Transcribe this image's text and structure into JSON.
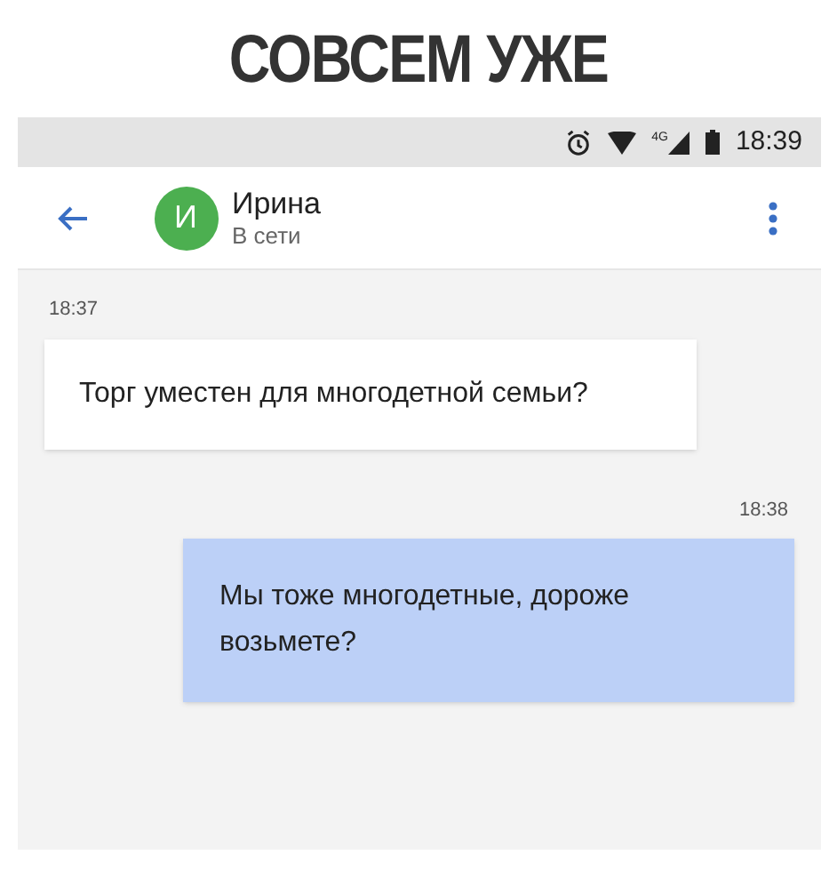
{
  "caption": "СОВСЕМ УЖЕ",
  "status_bar": {
    "network": "4G",
    "time": "18:39"
  },
  "header": {
    "avatar_letter": "И",
    "name": "Ирина",
    "status": "В сети"
  },
  "messages": [
    {
      "kind": "incoming",
      "time": "18:37",
      "text": "Торг уместен для многодетной семьи?"
    },
    {
      "kind": "outgoing",
      "time": "18:38",
      "text": "Мы тоже многодетные, дороже возьмете?"
    }
  ]
}
